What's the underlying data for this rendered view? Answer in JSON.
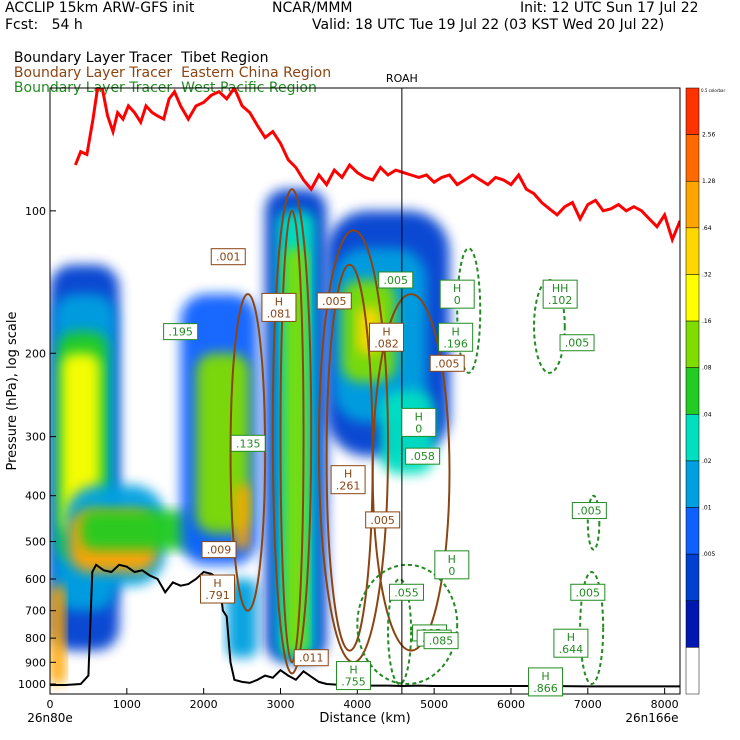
{
  "header": {
    "model": "ACCLIP 15km ARW-GFS init",
    "org": "NCAR/MMM",
    "init": "Init: 12 UTC Sun 17 Jul 22",
    "fcst": "Fcst:   54 h",
    "valid": "Valid: 18 UTC Tue 19 Jul 22 (03 KST Wed 20 Jul 22)"
  },
  "tracers": [
    {
      "prefix": "Boundary Layer Tracer",
      "region": "Tibet Region",
      "color": "#000000"
    },
    {
      "prefix": "Boundary Layer Tracer",
      "region": "Eastern China Region",
      "color": "#8b4513"
    },
    {
      "prefix": "Boundary Layer Tracer",
      "region": "West Pacific Region",
      "color": "#228b22"
    }
  ],
  "chart_data": {
    "type": "heatmap",
    "xlabel": "Distance (km)",
    "ylabel": "Pressure (hPa), log scale",
    "xlim": [
      0,
      8200
    ],
    "ylim": [
      1050,
      55
    ],
    "y_log_scale": true,
    "x_ticks": [
      0,
      1000,
      2000,
      3000,
      4000,
      5000,
      6000,
      7000,
      8000
    ],
    "x_tick_labels": [
      "0",
      "1000",
      "2000",
      "3000",
      "4000",
      "5000",
      "6000",
      "7000",
      "8000"
    ],
    "y_ticks": [
      100,
      200,
      300,
      400,
      500,
      600,
      700,
      800,
      900,
      1000
    ],
    "y_tick_labels": [
      "100",
      "200",
      "300",
      "400",
      "500",
      "600",
      "700",
      "800",
      "900",
      "1000"
    ],
    "x_start_label": "26n80e",
    "x_end_label": "26n166e",
    "marker_line": {
      "label": "ROAH",
      "x": 4580
    },
    "colorbar": {
      "top_label": "0.5 colorbar",
      "levels": [
        "2.56",
        "1.28",
        ".64",
        ".32",
        ".16",
        ".08",
        ".04",
        ".02",
        ".01",
        ".005"
      ],
      "colors": [
        "#ff3300",
        "#ff6a00",
        "#ffa500",
        "#ffd700",
        "#ffff00",
        "#7fdd00",
        "#22cc22",
        "#00e0c0",
        "#00a0e0",
        "#1060ff",
        "#0040d0",
        "#0018b0",
        "#ffffff"
      ]
    },
    "tropopause": {
      "color": "#ff0000",
      "x": [
        330,
        400,
        480,
        560,
        620,
        680,
        750,
        820,
        880,
        950,
        1020,
        1100,
        1180,
        1250,
        1330,
        1400,
        1480,
        1550,
        1620,
        1700,
        1800,
        1900,
        2000,
        2100,
        2200,
        2300,
        2400,
        2500,
        2600,
        2700,
        2800,
        2900,
        3000,
        3100,
        3200,
        3300,
        3400,
        3500,
        3600,
        3700,
        3800,
        3900,
        4000,
        4100,
        4200,
        4300,
        4400,
        4500,
        4600,
        4700,
        4800,
        4900,
        5000,
        5100,
        5200,
        5300,
        5400,
        5500,
        5600,
        5700,
        5800,
        5900,
        6000,
        6100,
        6200,
        6300,
        6400,
        6500,
        6600,
        6700,
        6800,
        6900,
        7000,
        7100,
        7200,
        7300,
        7400,
        7500,
        7600,
        7700,
        7800,
        7900,
        8000,
        8100,
        8200
      ],
      "p": [
        80,
        75,
        76,
        64,
        55,
        55,
        63,
        68,
        62,
        64,
        60,
        62,
        65,
        60,
        62,
        63,
        64,
        58,
        56,
        60,
        64,
        60,
        59,
        57,
        56,
        58,
        55,
        60,
        62,
        66,
        70,
        68,
        72,
        78,
        81,
        86,
        90,
        84,
        88,
        82,
        85,
        80,
        83,
        85,
        86,
        81,
        84,
        82,
        83,
        84,
        85,
        84,
        87,
        85,
        84,
        88,
        86,
        84,
        86,
        88,
        85,
        86,
        88,
        84,
        90,
        92,
        96,
        99,
        102,
        98,
        96,
        104,
        97,
        95,
        100,
        99,
        97,
        100,
        98,
        100,
        104,
        108,
        102,
        115,
        105
      ]
    },
    "terrain": {
      "color": "#000000",
      "x": [
        0,
        200,
        400,
        500,
        550,
        600,
        700,
        800,
        900,
        1000,
        1100,
        1200,
        1300,
        1400,
        1500,
        1600,
        1700,
        1800,
        1900,
        2000,
        2100,
        2200,
        2250,
        2300,
        2350,
        2400,
        2500,
        2600,
        2700,
        2800,
        2900,
        3000,
        3100,
        3200,
        3300,
        3400,
        3500,
        3600,
        3800,
        4000,
        4200,
        4400,
        4600,
        4800,
        5000,
        5500,
        6000,
        6500,
        7000,
        7500,
        8000,
        8200
      ],
      "p": [
        1005,
        1005,
        1000,
        960,
        580,
        560,
        575,
        580,
        560,
        565,
        580,
        575,
        590,
        600,
        640,
        610,
        620,
        615,
        600,
        580,
        585,
        600,
        700,
        720,
        900,
        980,
        990,
        995,
        980,
        960,
        970,
        935,
        960,
        980,
        940,
        965,
        990,
        1000,
        1005,
        1008,
        1008,
        1008,
        1010,
        1008,
        1010,
        1010,
        1010,
        1010,
        1012,
        1012,
        1012,
        1012
      ]
    },
    "eastern_china_max_labels": [
      {
        "label": "H",
        "value": ".081",
        "x": 2980,
        "p": 160
      },
      {
        "label": "H",
        "value": ".082",
        "x": 4380,
        "p": 185
      },
      {
        "label": "H",
        "value": ".261",
        "x": 3880,
        "p": 370
      },
      {
        "label": "H",
        "value": ".791",
        "x": 2180,
        "p": 630
      },
      {
        "label": "",
        "value": ".001",
        "x": 2320,
        "p": 125
      },
      {
        "label": "",
        "value": ".005",
        "x": 3700,
        "p": 155
      },
      {
        "label": "",
        "value": ".005",
        "x": 5170,
        "p": 210
      },
      {
        "label": "",
        "value": ".005",
        "x": 4330,
        "p": 450
      },
      {
        "label": "",
        "value": ".009",
        "x": 2200,
        "p": 520
      },
      {
        "label": "",
        "value": ".011",
        "x": 3400,
        "p": 880
      }
    ],
    "west_pacific_max_labels": [
      {
        "label": "H",
        "value": "0",
        "x": 5300,
        "p": 150
      },
      {
        "label": "HH",
        "value": ".102",
        "x": 6640,
        "p": 150
      },
      {
        "label": "H",
        "value": ".196",
        "x": 5280,
        "p": 185
      },
      {
        "label": "H",
        "value": "0",
        "x": 5230,
        "p": 560
      },
      {
        "label": "H",
        "value": ".644",
        "x": 6780,
        "p": 820
      },
      {
        "label": "",
        "value": ".005",
        "x": 6860,
        "p": 190
      },
      {
        "label": "",
        "value": ".005",
        "x": 7020,
        "p": 430
      },
      {
        "label": "",
        "value": ".005",
        "x": 7000,
        "p": 640
      },
      {
        "label": "",
        "value": ".005",
        "x": 4940,
        "p": 780
      },
      {
        "label": "",
        "value": ".055",
        "x": 4640,
        "p": 640
      }
    ],
    "tibet_max_labels": [
      {
        "label": "",
        "value": ".005",
        "x": 4500,
        "p": 140
      },
      {
        "label": "",
        "value": ".135",
        "x": 2580,
        "p": 310
      },
      {
        "label": "",
        "value": ".195",
        "x": 1700,
        "p": 180
      },
      {
        "label": "H",
        "value": "0",
        "x": 4800,
        "p": 280
      },
      {
        "label": "",
        "value": ".058",
        "x": 4850,
        "p": 330
      },
      {
        "label": "",
        "value": ".005",
        "x": 5000,
        "p": 800
      },
      {
        "label": "H",
        "value": ".755",
        "x": 3950,
        "p": 960
      },
      {
        "label": "H",
        "value": ".866",
        "x": 6450,
        "p": 990
      },
      {
        "label": "",
        "value": ".085",
        "x": 5090,
        "p": 810
      }
    ]
  }
}
